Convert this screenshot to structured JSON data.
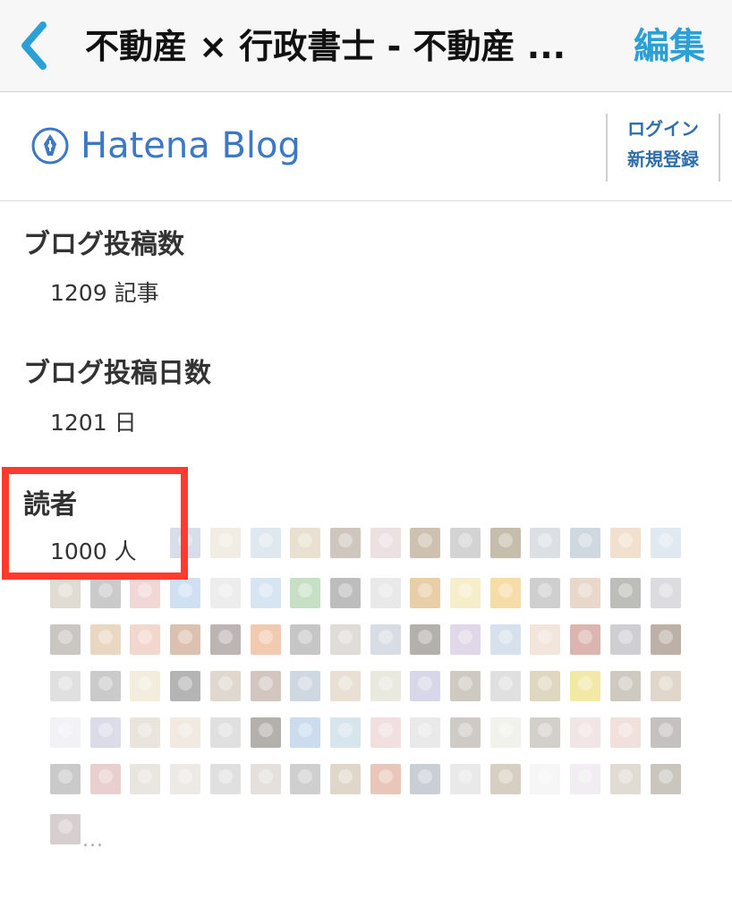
{
  "navbar": {
    "back_label": "<",
    "title": "不動産 × 行政書士 - 不動産 ...",
    "edit_label": "編集"
  },
  "header": {
    "logo_text": "Hatena Blog",
    "login_label": "ログイン",
    "signup_label": "新規登録"
  },
  "stats": {
    "posts": {
      "label": "ブログ投稿数",
      "value": "1209 記事"
    },
    "days": {
      "label": "ブログ投稿日数",
      "value": "1201 日"
    },
    "readers": {
      "label": "読者",
      "value": "1000 人"
    }
  },
  "readers_more": "...",
  "colors": {
    "accent": "#2aa0d6",
    "brand": "#3d78c4",
    "highlight": "#ff3b30"
  },
  "avatar_colors": [
    "#b8c3d8",
    "#e7e0d0",
    "#c8d6e3",
    "#d8c8a8",
    "#a89888",
    "#e0c8c8",
    "#a89070",
    "#b0b0b0",
    "#988868",
    "#c0c8d0",
    "#a8b8c8",
    "#e8c8a8",
    "#c8d8e8",
    "#c8c0b0",
    "#a0a0a0",
    "#e8b8b8",
    "#a8c8e8",
    "#e0e0e0",
    "#b8d0e8",
    "#98c898",
    "#888888",
    "#d8d8d8",
    "#d8a860",
    "#f0e0a0",
    "#f0c060",
    "#a8a8a8",
    "#d8b8a0",
    "#888880",
    "#c0c0c8",
    "#a09890",
    "#d8b890",
    "#e8b8a8",
    "#c09070",
    "#887878",
    "#e8a070",
    "#989898",
    "#c8c0b8",
    "#b8c0d0",
    "#787068",
    "#c8b8d8",
    "#b8c8e0",
    "#e8d0c0",
    "#c07870",
    "#a8a8b0",
    "#887060",
    "#c8c8c8",
    "#a0a0a0",
    "#e8e0c0",
    "#787878",
    "#c8b8a8",
    "#b09890",
    "#a8b8c8",
    "#d8c8b0",
    "#d8d8c8",
    "#b8b8d8",
    "#a8a090",
    "#c8c8c8",
    "#c8b890",
    "#e8d860",
    "#a8a090",
    "#c8b8a0",
    "#e8e8f0",
    "#c0c0d8",
    "#d8d0c0",
    "#e8d8c8",
    "#c8c8c8",
    "#787068",
    "#a0c0e0",
    "#b8d0e0",
    "#e8c8c8",
    "#d8d8d8",
    "#a8a098",
    "#e8e8e0",
    "#b0a8a0",
    "#e8d0d0",
    "#e8c8c0",
    "#989090",
    "#a0a0a0",
    "#d8a8a8",
    "#d8d0c8",
    "#e0d8d0",
    "#c8c8c8",
    "#d0c8c0",
    "#a8a8a8",
    "#c8b8a0",
    "#d89880",
    "#a0a8b8",
    "#d8d8d8",
    "#b8a890",
    "#f0f0f0",
    "#e8e0e8",
    "#c8c0b0",
    "#a09888",
    "#b8a8a8",
    "#f0f0e8",
    "#c89060",
    "#b8c8d8",
    "#a8a098",
    "#c8b8c0",
    "#e8e8e8",
    "#a0b0b8"
  ]
}
